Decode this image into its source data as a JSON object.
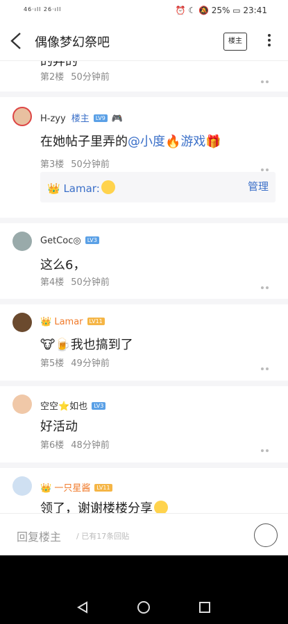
{
  "status": {
    "left": "46·ıll 26·ıll",
    "battery": "25%",
    "time": "23:41"
  },
  "header": {
    "title": "偶像梦幻祭吧",
    "owner_button": "楼主"
  },
  "posts": [
    {
      "floor": "第2楼",
      "time": "50分钟前",
      "partial_text": "的弄的"
    },
    {
      "user": "H-zyy",
      "owner_tag": "楼主",
      "level": "LV9",
      "text_a": "在她帖子里弄的",
      "mention": "@小度",
      "text_b": "游戏",
      "floor": "第3楼",
      "time": "50分钟前",
      "sub_user": "Lamar",
      "sub_sep": ":",
      "sub_manage": "管理"
    },
    {
      "user": "GetCoc◎",
      "level": "LV3",
      "text": "这么6，",
      "floor": "第4楼",
      "time": "50分钟前"
    },
    {
      "user": "Lamar",
      "level": "LV11",
      "text": "我也搞到了",
      "floor": "第5楼",
      "time": "49分钟前"
    },
    {
      "user": "空空⭐如也",
      "level": "LV3",
      "text": "好活动",
      "floor": "第6楼",
      "time": "48分钟前"
    },
    {
      "user": "一只星酱",
      "level": "LV11",
      "text": "领了，谢谢楼楼分享",
      "floor": "",
      "time": ""
    }
  ],
  "reply": {
    "placeholder": "回复楼主",
    "count": "/ 已有17条回贴"
  },
  "colors": {
    "accent": "#3a6fc8",
    "orange": "#f07a2a",
    "level_blue": "#5aa0e6",
    "level_orange": "#f5b545"
  }
}
